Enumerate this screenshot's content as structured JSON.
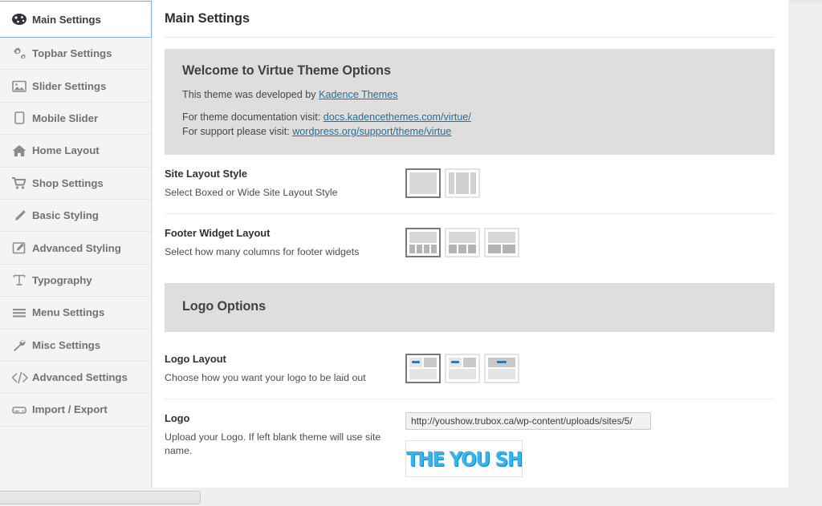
{
  "sidebar": {
    "items": [
      {
        "label": "Main Settings",
        "icon": "speedometer-icon",
        "active": true
      },
      {
        "label": "Topbar Settings",
        "icon": "gears-icon",
        "active": false
      },
      {
        "label": "Slider Settings",
        "icon": "image-icon",
        "active": false
      },
      {
        "label": "Mobile Slider",
        "icon": "tablet-icon",
        "active": false
      },
      {
        "label": "Home Layout",
        "icon": "home-icon",
        "active": false
      },
      {
        "label": "Shop Settings",
        "icon": "cart-icon",
        "active": false
      },
      {
        "label": "Basic Styling",
        "icon": "pencil-icon",
        "active": false
      },
      {
        "label": "Advanced Styling",
        "icon": "edit-square-icon",
        "active": false
      },
      {
        "label": "Typography",
        "icon": "text-t-icon",
        "active": false
      },
      {
        "label": "Menu Settings",
        "icon": "hamburger-icon",
        "active": false
      },
      {
        "label": "Misc Settings",
        "icon": "wrench-icon",
        "active": false
      },
      {
        "label": "Advanced Settings",
        "icon": "code-icon",
        "active": false
      },
      {
        "label": "Import / Export",
        "icon": "drive-icon",
        "active": false
      }
    ]
  },
  "main": {
    "page_title": "Main Settings",
    "welcome": {
      "title": "Welcome to Virtue Theme Options",
      "developed_prefix": "This theme was developed by ",
      "developed_link": "Kadence Themes",
      "docs_prefix": "For theme documentation visit: ",
      "docs_link": "docs.kadencethemes.com/virtue/",
      "support_prefix": "For support please visit: ",
      "support_link": "wordpress.org/support/theme/virtue"
    },
    "site_layout": {
      "title": "Site Layout Style",
      "desc": "Select Boxed or Wide Site Layout Style",
      "options": [
        {
          "name": "boxed",
          "selected": true
        },
        {
          "name": "wide",
          "selected": false
        }
      ]
    },
    "footer_widget": {
      "title": "Footer Widget Layout",
      "desc": "Select how many columns for footer widgets",
      "options": [
        {
          "name": "four-columns",
          "columns": 4,
          "selected": true
        },
        {
          "name": "three-columns",
          "columns": 3,
          "selected": false
        },
        {
          "name": "two-columns",
          "columns": 2,
          "selected": false
        }
      ]
    },
    "logo_options": {
      "band_title": "Logo Options",
      "logo_layout": {
        "title": "Logo Layout",
        "desc": "Choose how you want your logo to be laid out",
        "options": [
          {
            "name": "logo-left",
            "selected": true
          },
          {
            "name": "logo-left-menu-right",
            "selected": false
          },
          {
            "name": "logo-centered",
            "selected": false
          }
        ]
      },
      "logo": {
        "title": "Logo",
        "desc": "Upload your Logo. If left blank theme will use site name.",
        "url_value": "http://youshow.trubox.ca/wp-content/uploads/sites/5/",
        "preview_text": "THE YOU SH"
      }
    }
  },
  "colors": {
    "accent_link": "#1f6f9c",
    "band_gray": "#dedede",
    "active_border": "#7fb4d6",
    "logo_blue": "#32b6ef"
  }
}
